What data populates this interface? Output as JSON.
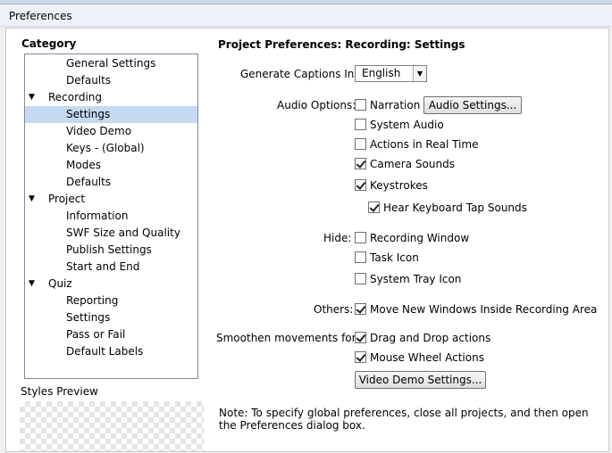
{
  "window": {
    "title": "Preferences"
  },
  "category": {
    "label": "Category",
    "items": [
      {
        "label": "General Settings",
        "level": 1
      },
      {
        "label": "Defaults",
        "level": 1
      },
      {
        "label": "Recording",
        "level": 0,
        "toggle": "▼"
      },
      {
        "label": "Settings",
        "level": 1,
        "selected": true
      },
      {
        "label": "Video Demo",
        "level": 1
      },
      {
        "label": "Keys - (Global)",
        "level": 1
      },
      {
        "label": "Modes",
        "level": 1
      },
      {
        "label": "Defaults",
        "level": 1
      },
      {
        "label": "Project",
        "level": 0,
        "toggle": "▼"
      },
      {
        "label": "Information",
        "level": 1
      },
      {
        "label": "SWF Size and Quality",
        "level": 1
      },
      {
        "label": "Publish Settings",
        "level": 1
      },
      {
        "label": "Start and End",
        "level": 1
      },
      {
        "label": "Quiz",
        "level": 0,
        "toggle": "▼"
      },
      {
        "label": "Reporting",
        "level": 1
      },
      {
        "label": "Settings",
        "level": 1
      },
      {
        "label": "Pass or Fail",
        "level": 1
      },
      {
        "label": "Default Labels",
        "level": 1
      }
    ]
  },
  "styles_preview": {
    "label": "Styles Preview"
  },
  "panel": {
    "title": "Project Preferences: Recording: Settings",
    "captions": {
      "label": "Generate Captions In:",
      "value": "English"
    },
    "audio": {
      "label": "Audio Options:",
      "settings_button": "Audio Settings...",
      "narration": {
        "label": "Narration",
        "checked": false
      },
      "system_audio": {
        "label": "System Audio",
        "checked": false
      },
      "real_time": {
        "label": "Actions in Real Time",
        "checked": false
      },
      "camera_sounds": {
        "label": "Camera Sounds",
        "checked": true
      },
      "keystrokes": {
        "label": "Keystrokes",
        "checked": true
      },
      "tap_sounds": {
        "label": "Hear Keyboard Tap Sounds",
        "checked": true
      }
    },
    "hide": {
      "label": "Hide:",
      "recording_window": {
        "label": "Recording Window",
        "checked": false
      },
      "task_icon": {
        "label": "Task Icon",
        "checked": false
      },
      "tray_icon": {
        "label": "System Tray Icon",
        "checked": false
      }
    },
    "others": {
      "label": "Others:",
      "move_windows": {
        "label": "Move New Windows Inside Recording Area",
        "checked": true
      }
    },
    "smoothen": {
      "label": "Smoothen movements for:",
      "drag_drop": {
        "label": "Drag and Drop actions",
        "checked": true
      },
      "mouse_wheel": {
        "label": "Mouse Wheel Actions",
        "checked": true
      }
    },
    "video_demo_button": "Video Demo Settings...",
    "note": "Note: To specify global preferences, close all projects, and then open the Preferences dialog box."
  }
}
